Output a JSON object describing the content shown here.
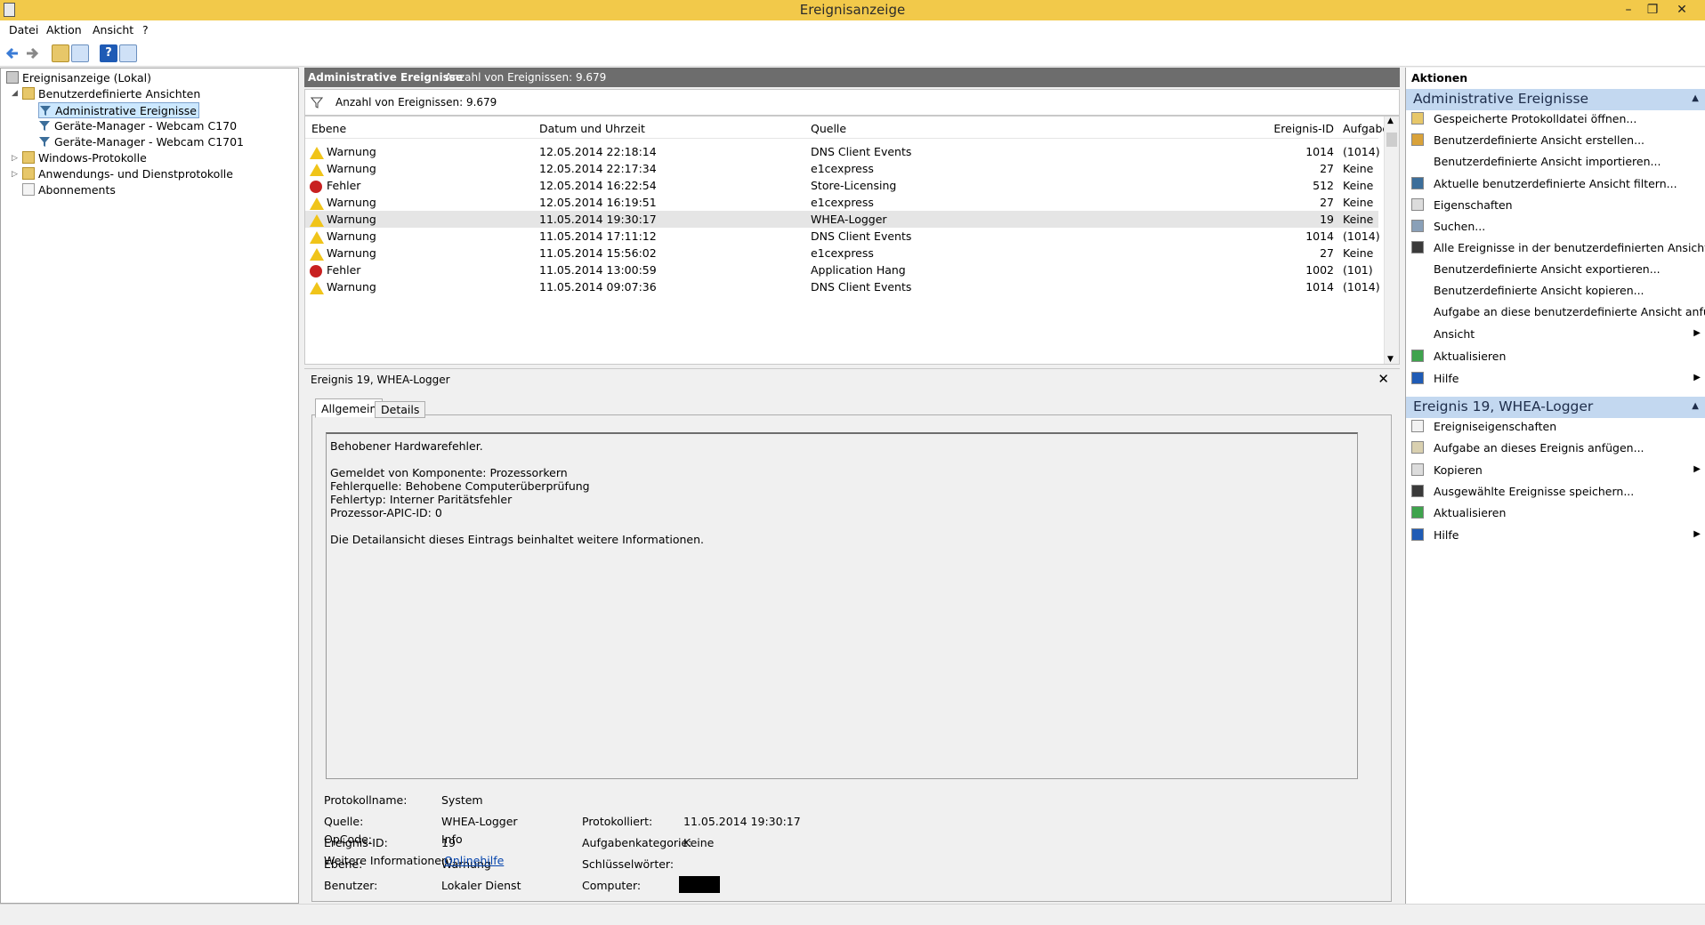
{
  "window": {
    "title": "Ereignisanzeige",
    "minimize": "–",
    "restore": "❐",
    "close": "✕"
  },
  "menu": [
    "Datei",
    "Aktion",
    "Ansicht",
    "?"
  ],
  "tree": {
    "root": "Ereignisanzeige (Lokal)",
    "custom_views": "Benutzerdefinierte Ansichten",
    "admin_events": "Administrative Ereignisse",
    "webcam1": "Geräte-Manager - Webcam C170",
    "webcam2": "Geräte-Manager - Webcam C1701",
    "windows_logs": "Windows-Protokolle",
    "app_logs": "Anwendungs- und Dienstprotokolle",
    "subscriptions": "Abonnements"
  },
  "list": {
    "title": "Administrative Ereignisse",
    "count_label": "Anzahl von Ereignissen: 9.679",
    "filter_label": "Anzahl von Ereignissen: 9.679",
    "columns": [
      "Ebene",
      "Datum und Uhrzeit",
      "Quelle",
      "Ereignis-ID",
      "Aufgabenkategorie"
    ],
    "rows": [
      {
        "level": "Warnung",
        "date": "12.05.2014 22:18:14",
        "source": "DNS Client Events",
        "id": "1014",
        "cat": "(1014)"
      },
      {
        "level": "Warnung",
        "date": "12.05.2014 22:17:34",
        "source": "e1cexpress",
        "id": "27",
        "cat": "Keine"
      },
      {
        "level": "Fehler",
        "date": "12.05.2014 16:22:54",
        "source": "Store-Licensing",
        "id": "512",
        "cat": "Keine"
      },
      {
        "level": "Warnung",
        "date": "12.05.2014 16:19:51",
        "source": "e1cexpress",
        "id": "27",
        "cat": "Keine"
      },
      {
        "level": "Warnung",
        "date": "11.05.2014 19:30:17",
        "source": "WHEA-Logger",
        "id": "19",
        "cat": "Keine"
      },
      {
        "level": "Warnung",
        "date": "11.05.2014 17:11:12",
        "source": "DNS Client Events",
        "id": "1014",
        "cat": "(1014)"
      },
      {
        "level": "Warnung",
        "date": "11.05.2014 15:56:02",
        "source": "e1cexpress",
        "id": "27",
        "cat": "Keine"
      },
      {
        "level": "Fehler",
        "date": "11.05.2014 13:00:59",
        "source": "Application Hang",
        "id": "1002",
        "cat": "(101)"
      },
      {
        "level": "Warnung",
        "date": "11.05.2014 09:07:36",
        "source": "DNS Client Events",
        "id": "1014",
        "cat": "(1014)"
      }
    ]
  },
  "detail": {
    "title": "Ereignis 19, WHEA-Logger",
    "tab_general": "Allgemein",
    "tab_details": "Details",
    "message": [
      "Behobener Hardwarefehler.",
      "",
      "Gemeldet von Komponente: Prozessorkern",
      "Fehlerquelle: Behobene Computerüberprüfung",
      "Fehlertyp: Interner Paritätsfehler",
      "Prozessor-APIC-ID: 0",
      "",
      "Die Detailansicht dieses Eintrags beinhaltet weitere Informationen."
    ],
    "props": {
      "log_name_label": "Protokollname:",
      "log_name": "System",
      "source_label": "Quelle:",
      "source": "WHEA-Logger",
      "logged_label": "Protokolliert:",
      "logged": "11.05.2014 19:30:17",
      "event_id_label": "Ereignis-ID:",
      "event_id": "19",
      "task_cat_label": "Aufgabenkategorie:",
      "task_cat": "Keine",
      "level_label": "Ebene:",
      "level": "Warnung",
      "keywords_label": "Schlüsselwörter:",
      "user_label": "Benutzer:",
      "user": "Lokaler Dienst",
      "computer_label": "Computer:",
      "opcode_label": "OpCode:",
      "opcode": "Info",
      "more_info_label": "Weitere Informationen:",
      "more_info_link": "Onlinehilfe"
    }
  },
  "actions": {
    "header": "Aktionen",
    "section1_title": "Administrative Ereignisse",
    "section1": [
      "Gespeicherte Protokolldatei öffnen...",
      "Benutzerdefinierte Ansicht erstellen...",
      "Benutzerdefinierte Ansicht importieren...",
      "Aktuelle benutzerdefinierte Ansicht filtern...",
      "Eigenschaften",
      "Suchen...",
      "Alle Ereignisse in der benutzerdefinierten Ansicht sp...",
      "Benutzerdefinierte Ansicht exportieren...",
      "Benutzerdefinierte Ansicht kopieren...",
      "Aufgabe an diese benutzerdefinierte Ansicht anfüge...",
      "Ansicht",
      "Aktualisieren",
      "Hilfe"
    ],
    "section2_title": "Ereignis 19, WHEA-Logger",
    "section2": [
      "Ereigniseigenschaften",
      "Aufgabe an dieses Ereignis anfügen...",
      "Kopieren",
      "Ausgewählte Ereignisse speichern...",
      "Aktualisieren",
      "Hilfe"
    ]
  }
}
